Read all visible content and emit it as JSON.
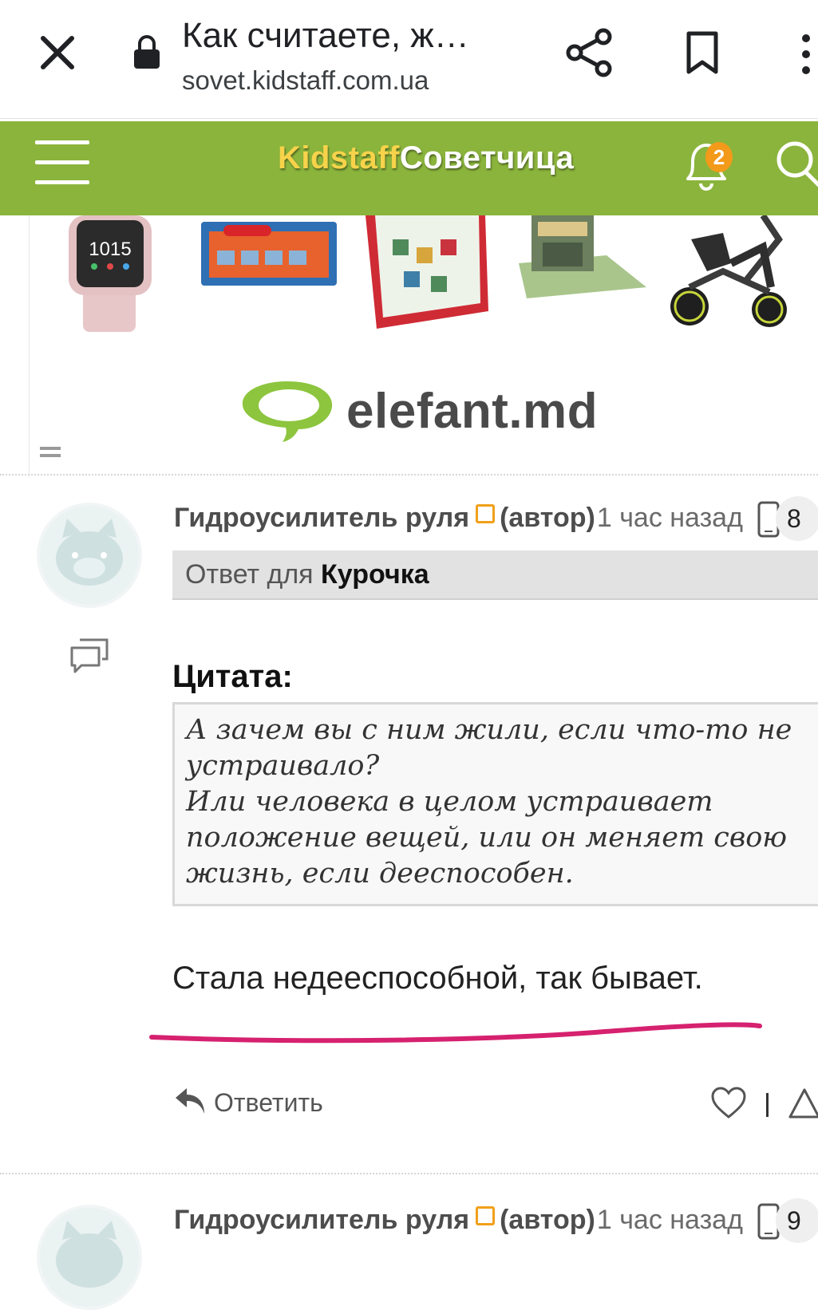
{
  "browser": {
    "title": "Как считаете, ж…",
    "url": "sovet.kidstaff.com.ua"
  },
  "site": {
    "logo_part1": "Kidstaff",
    "logo_part2": "Советчица",
    "notifications_count": "2"
  },
  "ad": {
    "brand": "elefant.md",
    "watch_time": "1015"
  },
  "comments": [
    {
      "author": "Гидроусилитель руля",
      "role": "(автор)",
      "time": "1 час назад",
      "count": "8",
      "reply_to_prefix": "Ответ для",
      "reply_to_name": "Курочка",
      "quote_label": "Цитата:",
      "quote_lines": [
        "А зачем вы с ним жили, если что-то не",
        "устраивало?",
        "Или человека в целом устраивает",
        "положение вещей, или он меняет свою",
        "жизнь, если дееспособен."
      ],
      "body": "Стала недееспособной, так бывает.",
      "reply_label": "Ответить"
    },
    {
      "author": "Гидроусилитель руля",
      "role": "(автор)",
      "time": "1 час назад",
      "count": "9"
    }
  ],
  "colors": {
    "header_green": "#8bb43c",
    "logo_yellow": "#f6d34a",
    "badge_orange": "#f39a1a",
    "underline_pink": "#d6216f"
  }
}
